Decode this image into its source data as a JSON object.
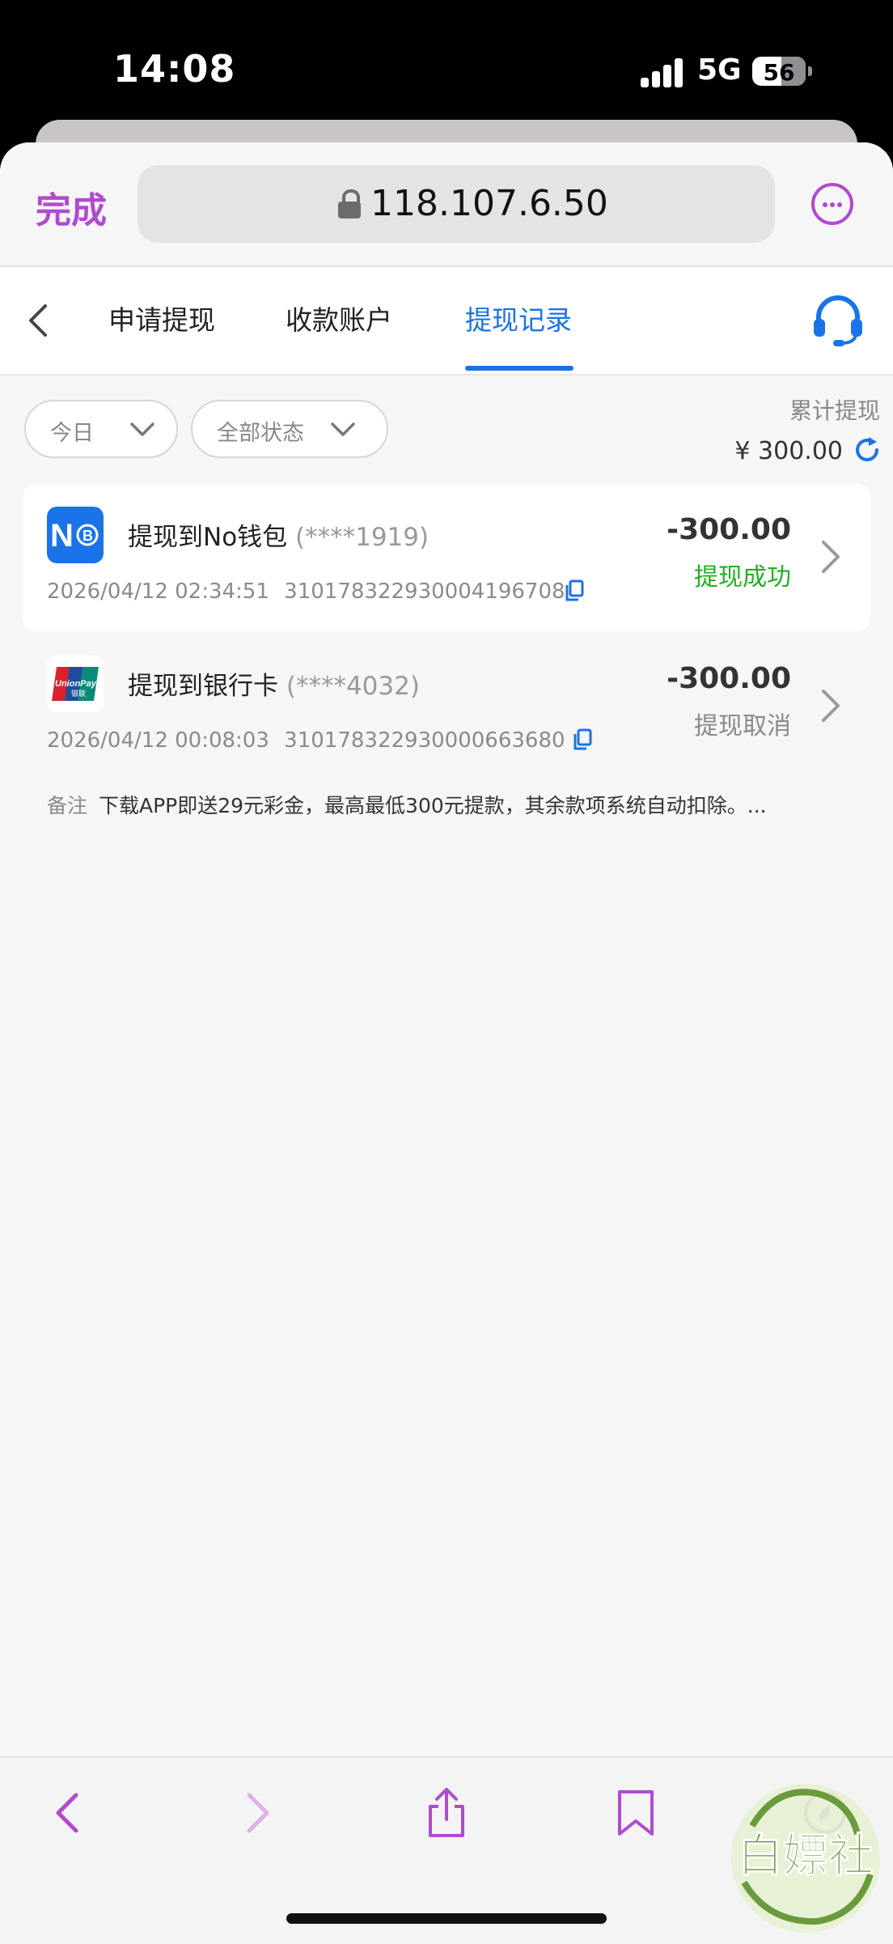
{
  "status_bar": {
    "time": "14:08",
    "network": "5G",
    "battery": "56"
  },
  "browser": {
    "done_label": "完成",
    "url": "118.107.6.50"
  },
  "nav": {
    "tabs": [
      {
        "label": "申请提现",
        "active": false
      },
      {
        "label": "收款账户",
        "active": false
      },
      {
        "label": "提现记录",
        "active": true
      }
    ]
  },
  "filters": {
    "date": "今日",
    "status": "全部状态"
  },
  "summary": {
    "label": "累计提现",
    "value": "¥ 300.00"
  },
  "records": [
    {
      "logo": "nobank-wallet-logo",
      "title": "提现到No钱包",
      "masked": "(****1919)",
      "datetime": "2026/04/12 02:34:51",
      "order_no": "310178322930004196708",
      "amount": "-300.00",
      "status": "提现成功",
      "status_color": "#22b022"
    },
    {
      "logo": "unionpay-logo",
      "title": "提现到银行卡",
      "masked": "(****4032)",
      "datetime": "2026/04/12 00:08:03",
      "order_no": "310178322930000663680",
      "amount": "-300.00",
      "status": "提现取消",
      "status_color": "#8a8a8a",
      "note_label": "备注",
      "note": "下载APP即送29元彩金，最高最低300元提款，其余款项系统自动扣除。..."
    }
  ],
  "watermark_text": "白嫖社",
  "colors": {
    "accent": "#1a73e8",
    "browser_accent": "#b04ad0",
    "success": "#22b022"
  }
}
